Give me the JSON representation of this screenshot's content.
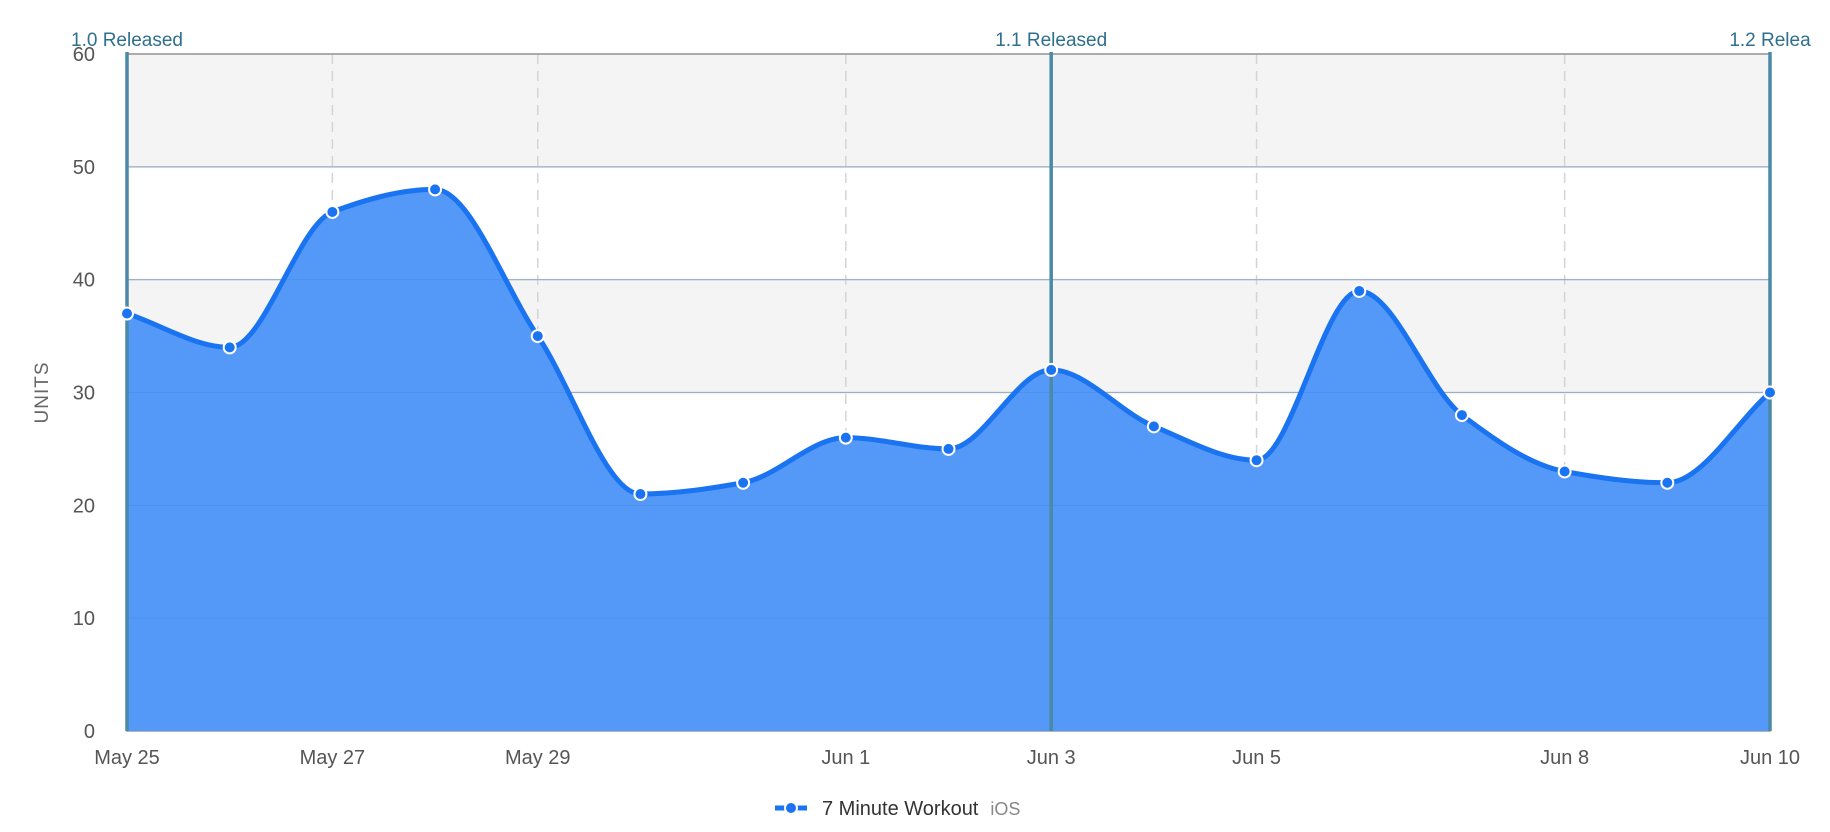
{
  "chart_data": {
    "type": "area",
    "xlabel": "",
    "ylabel": "UNITS",
    "ylim": [
      0,
      60
    ],
    "yticks": [
      0,
      10,
      20,
      30,
      40,
      50,
      60
    ],
    "xlim": [
      "May 25",
      "Jun 10"
    ],
    "xticks": [
      "May 25",
      "May 27",
      "May 29",
      "Jun 1",
      "Jun 3",
      "Jun 5",
      "Jun 8",
      "Jun 10"
    ],
    "x": [
      "May 25",
      "May 26",
      "May 27",
      "May 28",
      "May 29",
      "May 30",
      "May 31",
      "Jun 1",
      "Jun 2",
      "Jun 3",
      "Jun 4",
      "Jun 5",
      "Jun 6",
      "Jun 7",
      "Jun 8",
      "Jun 9",
      "Jun 10"
    ],
    "series": [
      {
        "name": "7 Minute Workout",
        "sublabel": "iOS",
        "color": "#1a73f0",
        "fill": "#5599f8",
        "values": [
          37,
          34,
          46,
          48,
          35,
          21,
          22,
          26,
          25,
          32,
          27,
          24,
          39,
          28,
          23,
          22,
          30
        ]
      }
    ],
    "annotations": [
      {
        "label": "1.0 Released",
        "x": "May 25"
      },
      {
        "label": "1.1 Released",
        "x": "Jun 3"
      },
      {
        "label": "1.2 Relea",
        "x": "Jun 10"
      }
    ],
    "grid": true,
    "alternate_bands": true,
    "legend_position": "bottom-center",
    "colors": {
      "annotation_line": "#4a8aa6",
      "annotation_text": "#2e6f8e",
      "band": "#f4f4f4",
      "grid": "#c8c8c8",
      "vgrid": "#d4d4d4"
    }
  }
}
